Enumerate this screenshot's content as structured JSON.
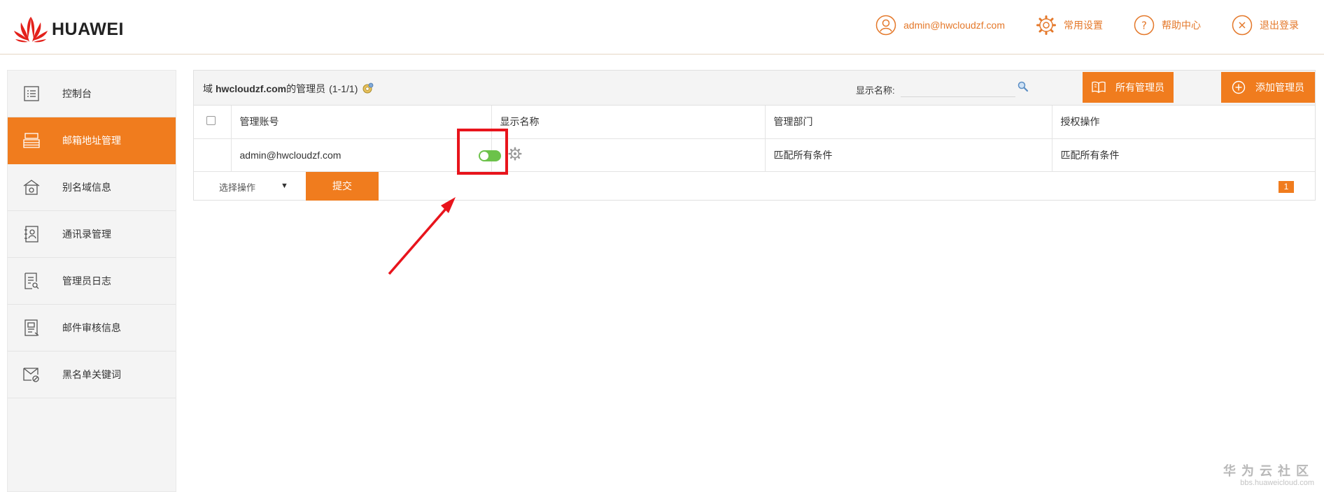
{
  "brand": {
    "name": "HUAWEI"
  },
  "header": {
    "user_email": "admin@hwcloudzf.com",
    "settings_label": "常用设置",
    "help_label": "帮助中心",
    "logout_label": "退出登录"
  },
  "sidebar": {
    "items": [
      {
        "label": "控制台",
        "icon": "list-icon"
      },
      {
        "label": "邮箱地址管理",
        "icon": "mailbox-icon",
        "active": true
      },
      {
        "label": "别名域信息",
        "icon": "house-icon"
      },
      {
        "label": "通讯录管理",
        "icon": "contacts-icon"
      },
      {
        "label": "管理员日志",
        "icon": "log-search-icon"
      },
      {
        "label": "邮件审核信息",
        "icon": "audit-doc-icon"
      },
      {
        "label": "黑名单关键词",
        "icon": "blocked-mail-icon"
      }
    ]
  },
  "panel": {
    "title_prefix": "域",
    "domain": "hwcloudzf.com",
    "title_suffix": "的管理员",
    "count": "(1-1/1)",
    "search_label": "显示名称:",
    "search_value": "",
    "btn_all_admins": "所有管理员",
    "btn_add_admin": "添加管理员"
  },
  "table": {
    "headers": [
      "管理账号",
      "显示名称",
      "管理部门",
      "授权操作"
    ],
    "rows": [
      {
        "account": "admin@hwcloudzf.com",
        "display_name": "",
        "department": "匹配所有条件",
        "authorization": "匹配所有条件",
        "enabled": true
      }
    ]
  },
  "footer": {
    "select_label": "选择操作",
    "submit_label": "提交",
    "page": "1"
  },
  "watermark": {
    "title": "华为云社区",
    "url": "bbs.huaweicloud.com"
  },
  "colors": {
    "accent": "#f07c1e",
    "header_link": "#e4782a",
    "annotation": "#e8141c",
    "toggle_on": "#6cc24a"
  }
}
